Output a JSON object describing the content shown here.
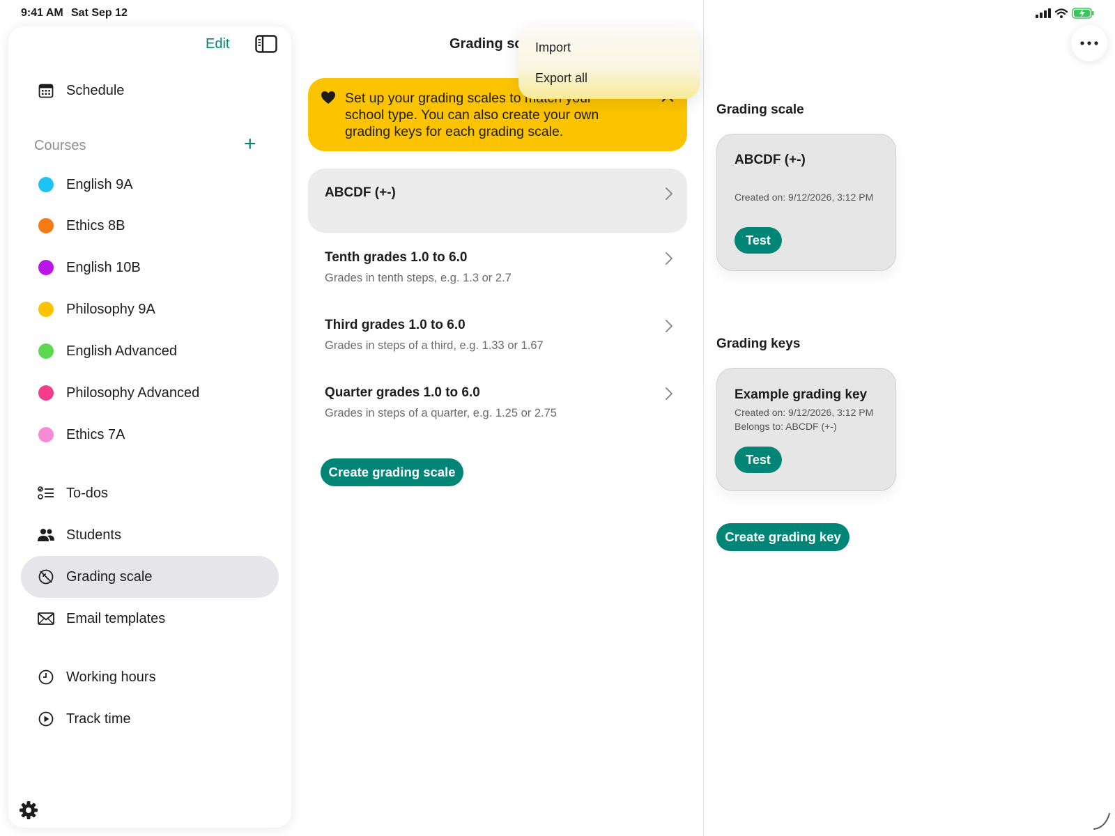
{
  "status_bar": {
    "time": "9:41 AM",
    "date": "Sat Sep 12"
  },
  "sidebar": {
    "edit_label": "Edit",
    "top_items": [
      {
        "label": "Schedule",
        "icon": "calendar-icon"
      }
    ],
    "courses_label": "Courses",
    "courses": [
      {
        "label": "English 9A",
        "color": "#1ec3f5"
      },
      {
        "label": "Ethics 8B",
        "color": "#f57a14"
      },
      {
        "label": "English 10B",
        "color": "#bb14e6"
      },
      {
        "label": "Philosophy 9A",
        "color": "#fcc400"
      },
      {
        "label": "English Advanced",
        "color": "#5cd84e"
      },
      {
        "label": "Philosophy Advanced",
        "color": "#f53c8c"
      },
      {
        "label": "Ethics 7A",
        "color": "#f78cd6"
      }
    ],
    "nav": [
      {
        "label": "To-dos",
        "icon": "todo-list-icon"
      },
      {
        "label": "Students",
        "icon": "people-icon"
      },
      {
        "label": "Grading scale",
        "icon": "grading-scale-icon",
        "active": true
      },
      {
        "label": "Email templates",
        "icon": "envelope-icon"
      }
    ],
    "time_items": [
      {
        "label": "Working hours",
        "icon": "clock-icon"
      },
      {
        "label": "Track time",
        "icon": "play-circle-icon"
      }
    ]
  },
  "middle": {
    "title": "Grading sc",
    "banner": "Set up your grading scales to match your school type. You can also create your own grading keys for each grading scale.",
    "scales": [
      {
        "title": "ABCDF (+-)",
        "subtitle": ""
      },
      {
        "title": "Tenth grades 1.0 to 6.0",
        "subtitle": "Grades in tenth steps, e.g. 1.3 or 2.7"
      },
      {
        "title": "Third grades 1.0 to 6.0",
        "subtitle": "Grades in steps of a third, e.g. 1.33 or 1.67"
      },
      {
        "title": "Quarter grades 1.0 to 6.0",
        "subtitle": "Grades in steps of a quarter, e.g. 1.25 or 2.75"
      }
    ],
    "create_button": "Create grading scale"
  },
  "menu": {
    "items": [
      "Import",
      "Export all"
    ]
  },
  "detail": {
    "scale_section": "Grading scale",
    "scale_card": {
      "title": "ABCDF (+-)",
      "created": "Created on: 9/12/2026, 3:12 PM",
      "test_label": "Test"
    },
    "keys_section": "Grading keys",
    "key_card": {
      "title": "Example grading key",
      "created": "Created on: 9/12/2026, 3:12 PM",
      "belongs": "Belongs to: ABCDF (+-)",
      "test_label": "Test"
    },
    "create_key_button": "Create grading key"
  },
  "colors": {
    "accent": "#008577",
    "banner": "#fcc400",
    "selected_row": "#ececec"
  }
}
